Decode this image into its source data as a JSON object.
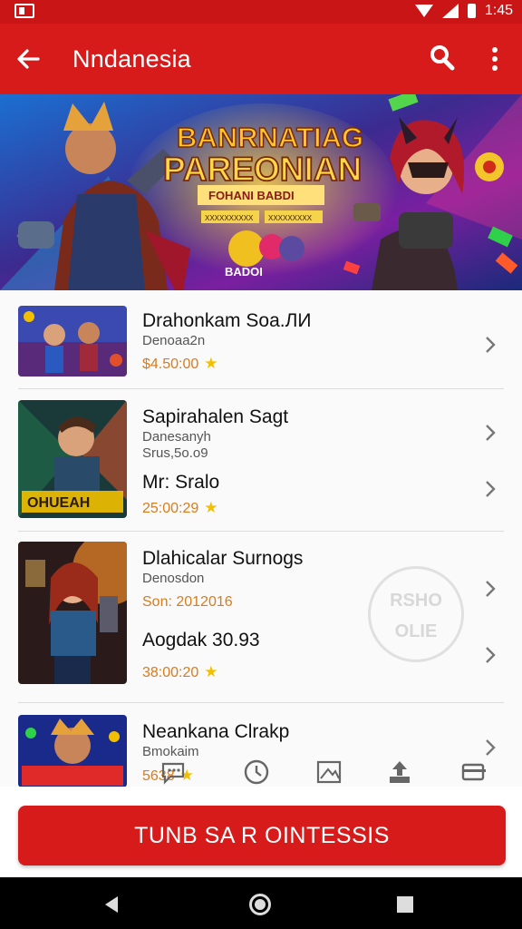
{
  "status_bar": {
    "time": "1:45"
  },
  "app_bar": {
    "title": "Nndanesia",
    "back_icon": "arrow-left-icon",
    "search_icon": "search-icon",
    "more_icon": "more-vert-icon"
  },
  "banner": {
    "title_line1": "BANRNATIAG",
    "title_line2": "PAREONIAN",
    "subtitle": "FOHANI BABDI",
    "tag1": "XXXXXXXXXX",
    "tag2": "XXXXXXXXX",
    "tag3": "XXXXXXXXX",
    "badge": "BADOI"
  },
  "items": [
    {
      "title": "Drahonkam Soa.ЛИ",
      "sub": "Denoaa2n",
      "price": "$4.50:00"
    },
    {
      "title": "Sapirahalen Sagt",
      "sub": "Danesanyh",
      "sub2": "Srus,5o.o9",
      "title2": "Mr: Sralo",
      "price": "25:00:29",
      "thumb_text": "OHUEAH"
    },
    {
      "title": "Dlahicalar Surnogs",
      "sub": "Denosdon",
      "price": "Son: 2012016",
      "title2": "Aogdak 30.93",
      "price2": "38:00:20"
    },
    {
      "title": "Neankana Clrakp",
      "sub": "Bmokaim",
      "price": "5638"
    }
  ],
  "watermark": {
    "line1": "RSHO",
    "line2": "OLIE"
  },
  "cta": {
    "label": "TUNB SA R OINTESSIS"
  },
  "colors": {
    "primary": "#d71a1a",
    "price": "#d97b1a",
    "star": "#f2c000"
  }
}
